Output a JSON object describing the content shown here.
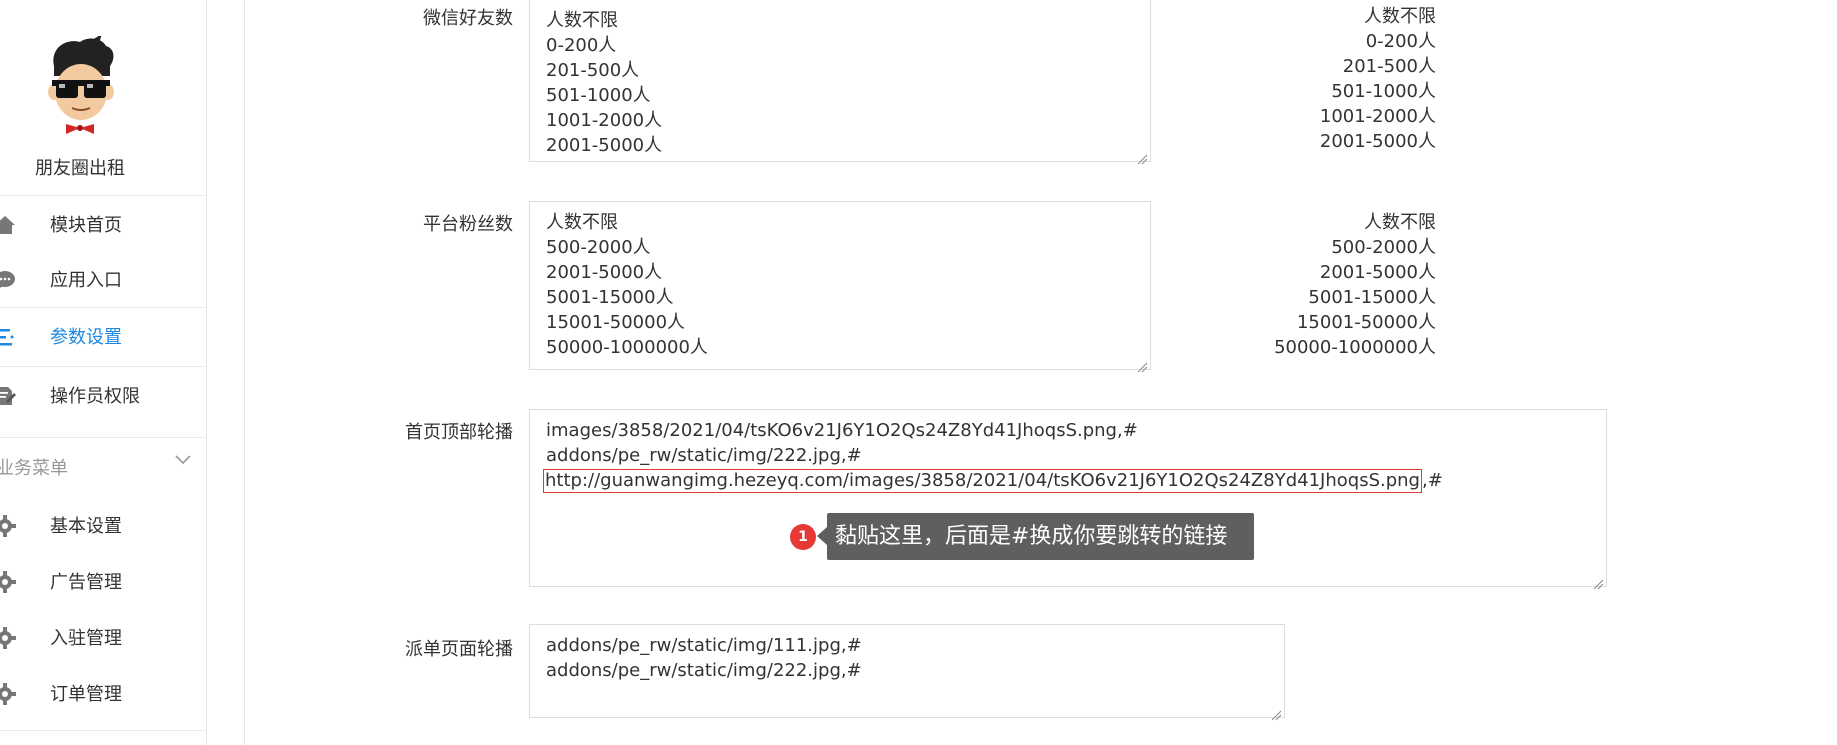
{
  "sidebar": {
    "app_name": "朋友圈出租",
    "items_top": [
      {
        "label": "模块首页",
        "icon": "home-icon"
      },
      {
        "label": "应用入口",
        "icon": "chat-bubble-icon"
      },
      {
        "label": "参数设置",
        "icon": "list-settings-icon",
        "active": true
      },
      {
        "label": "操作员权限",
        "icon": "edit-document-icon"
      }
    ],
    "section_label": "业务菜单",
    "items_business": [
      {
        "label": "基本设置",
        "icon": "gear-icon"
      },
      {
        "label": "广告管理",
        "icon": "gear-icon"
      },
      {
        "label": "入驻管理",
        "icon": "gear-icon"
      },
      {
        "label": "订单管理",
        "icon": "gear-icon"
      }
    ],
    "active_color": "#1e88e5"
  },
  "form": {
    "wechat_friends": {
      "label": "微信好友数",
      "lines": [
        "人数不限",
        "0-200人",
        "201-500人",
        "501-1000人",
        "1001-2000人",
        "2001-5000人"
      ],
      "preview": [
        "人数不限",
        "0-200人",
        "201-500人",
        "501-1000人",
        "1001-2000人",
        "2001-5000人"
      ]
    },
    "platform_fans": {
      "label": "平台粉丝数",
      "lines": [
        "人数不限",
        "500-2000人",
        "2001-5000人",
        "5001-15000人",
        "15001-50000人",
        "50000-1000000人"
      ],
      "preview": [
        "人数不限",
        "500-2000人",
        "2001-5000人",
        "5001-15000人",
        "15001-50000人",
        "50000-1000000人"
      ]
    },
    "home_carousel": {
      "label": "首页顶部轮播",
      "line1": "images/3858/2021/04/tsKO6v21J6Y1O2Qs24Z8Yd41JhoqsS.png,#",
      "line2": "addons/pe_rw/static/img/222.jpg,#",
      "line3_url": "http://guanwangimg.hezeyq.com/images/3858/2021/04/tsKO6v21J6Y1O2Qs24Z8Yd41JhoqsS.png",
      "line3_suffix": ",#"
    },
    "dispatch_carousel": {
      "label": "派单页面轮播",
      "lines": [
        "addons/pe_rw/static/img/111.jpg,#",
        "addons/pe_rw/static/img/222.jpg,#"
      ]
    }
  },
  "annotation": {
    "badge": "1",
    "text": "黏贴这里，后面是#换成你要跳转的链接",
    "highlight_color": "#e53935"
  }
}
